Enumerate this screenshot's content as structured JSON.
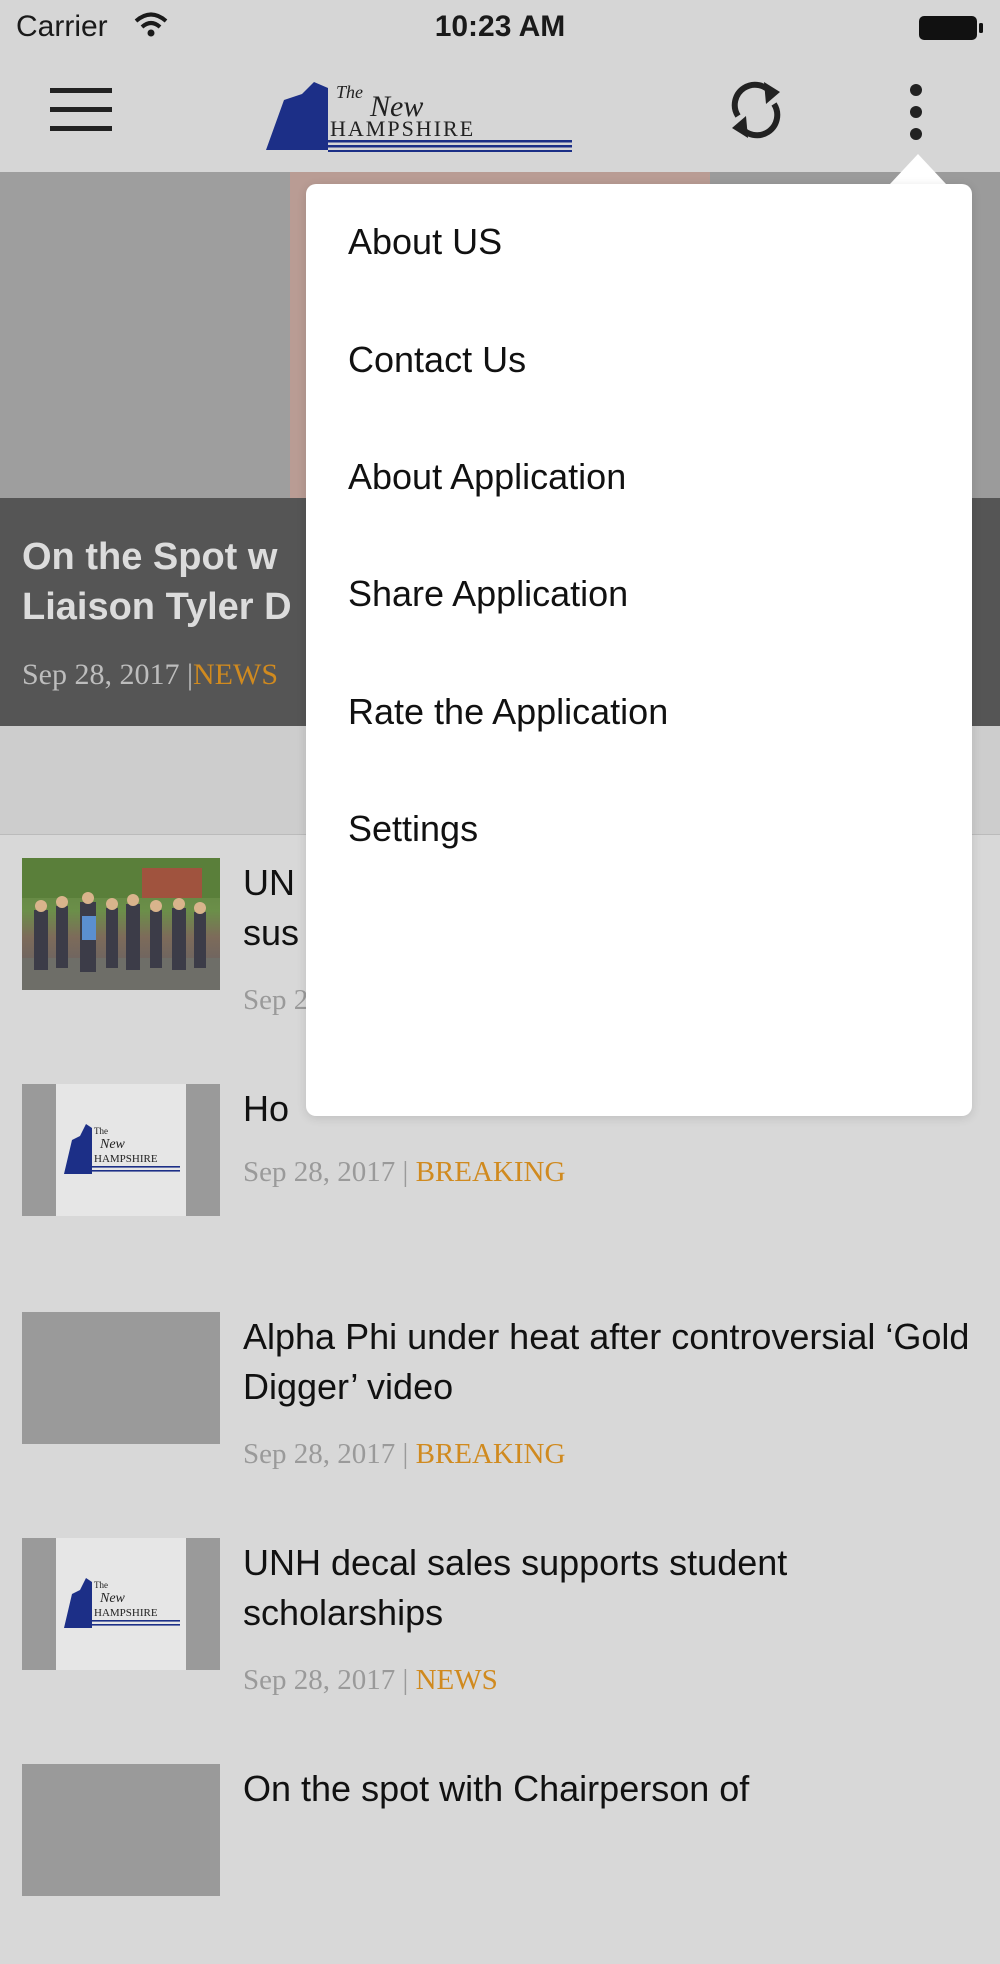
{
  "status_bar": {
    "carrier": "Carrier",
    "time": "10:23 AM"
  },
  "nav": {
    "logo_icon": "new-hampshire-logo",
    "icons": [
      "menu-icon",
      "refresh-icon",
      "more-vertical-icon"
    ]
  },
  "hero": {
    "title": "On the Spot w\nLiaison Tyler D",
    "date": "Sep 28, 2017 |",
    "category": "NEWS"
  },
  "articles": [
    {
      "title": "UN\nsus",
      "date": "Sep 2",
      "category": ""
    },
    {
      "title": "Ho",
      "date": "Sep 28, 2017 |",
      "category": "BREAKING"
    },
    {
      "title": "Alpha Phi under heat after controversial ‘Gold Digger’ video",
      "date": "Sep 28, 2017 |",
      "category": "BREAKING"
    },
    {
      "title": "UNH decal sales supports student scholarships",
      "date": "Sep 28, 2017 |",
      "category": "NEWS"
    },
    {
      "title": "On the spot with Chairperson of",
      "date": "",
      "category": ""
    }
  ],
  "menu": {
    "items": [
      "About US",
      "Contact Us",
      "About Application",
      "Share Application",
      "Rate the Application",
      "Settings"
    ]
  },
  "colors": {
    "accent": "#d08a1f",
    "logo_blue": "#1c2f87",
    "background": "#d8d8d8"
  }
}
